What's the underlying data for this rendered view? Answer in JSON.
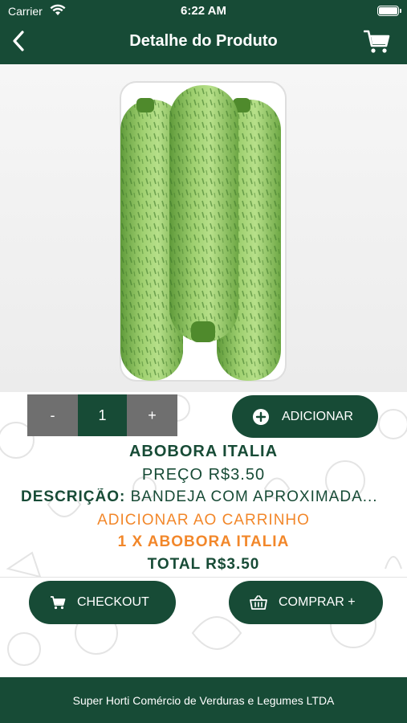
{
  "status_bar": {
    "carrier": "Carrier",
    "time": "6:22 AM"
  },
  "nav": {
    "title": "Detalhe do Produto"
  },
  "product": {
    "name": "ABOBORA ITALIA",
    "price_text": "PREÇO R$3.50",
    "description_label": "DESCRIÇÃO:",
    "description_text": "BANDEJA COM APROXIMADA...",
    "image_alt_icon": "zucchini-image"
  },
  "stepper": {
    "minus": "-",
    "quantity": "1",
    "plus": "+"
  },
  "add_button": {
    "label": "ADICIONAR"
  },
  "cart_summary": {
    "add_to_cart": "ADICIONAR AO CARRINHO",
    "line": "1 X ABOBORA ITALIA",
    "total": "TOTAL R$3.50"
  },
  "actions": {
    "checkout": "CHECKOUT",
    "comprar": "COMPRAR +"
  },
  "footer": {
    "text": "Super Horti Comércio de Verduras e Legumes LTDA"
  },
  "colors": {
    "primary": "#174b36",
    "accent": "#f2872a",
    "stepper_gray": "#6f6f6f"
  }
}
